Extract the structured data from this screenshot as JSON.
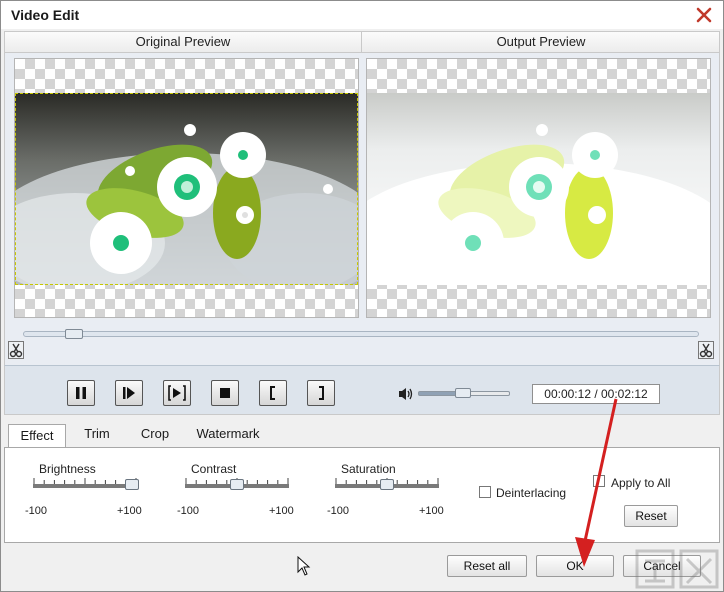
{
  "window": {
    "title": "Video Edit"
  },
  "preview": {
    "original_label": "Original Preview",
    "output_label": "Output Preview",
    "timeline_position": 0.06
  },
  "playback": {
    "time": "00:00:12 / 00:02:12",
    "volume_level": 0.48
  },
  "tabs": [
    {
      "label": "Effect",
      "active": true
    },
    {
      "label": "Trim",
      "active": false
    },
    {
      "label": "Crop",
      "active": false
    },
    {
      "label": "Watermark",
      "active": false
    }
  ],
  "effect": {
    "brightness": {
      "label": "Brightness",
      "min": "-100",
      "max": "+100",
      "value": 90
    },
    "contrast": {
      "label": "Contrast",
      "min": "-100",
      "max": "+100",
      "value": 0
    },
    "saturation": {
      "label": "Saturation",
      "min": "-100",
      "max": "+100",
      "value": 0
    },
    "deinterlacing_label": "Deinterlacing",
    "apply_all_label": "Apply to All",
    "reset_label": "Reset"
  },
  "footer": {
    "reset_all_label": "Reset all",
    "ok_label": "OK",
    "cancel_label": "Cancel"
  },
  "colors": {
    "annotation_arrow": "#d42020",
    "control_bar": "#dde4ec",
    "accent_green": "#1fbf7a"
  }
}
